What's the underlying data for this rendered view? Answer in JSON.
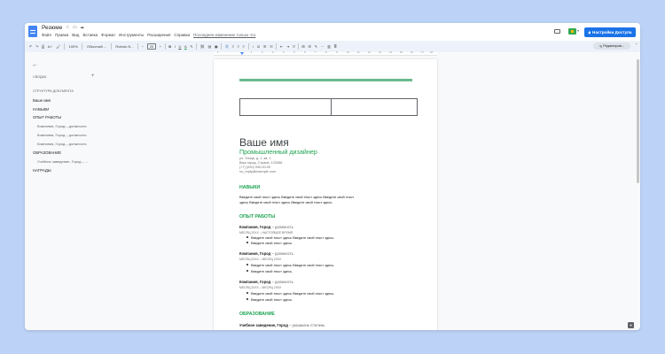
{
  "header": {
    "title": "Резюме",
    "menu": [
      "Файл",
      "Правка",
      "Вид",
      "Вставка",
      "Формат",
      "Инструменты",
      "Расширения",
      "Справка"
    ],
    "last_edit": "Последнее изменение только что",
    "share_label": "Настройки Доступа"
  },
  "toolbar": {
    "zoom": "100%",
    "style": "Обычный ...",
    "font": "Roboto N...",
    "font_size": "20",
    "edit_mode": "Редактиров..."
  },
  "ruler": {
    "numbers": [
      "1",
      "1",
      "2",
      "3",
      "4",
      "5",
      "6",
      "7",
      "8",
      "9",
      "10",
      "11",
      "12",
      "13",
      "14",
      "15",
      "16",
      "17",
      "18"
    ]
  },
  "sidebar": {
    "summary_label": "СВОДКА",
    "outline_label": "СТРУКТУРА ДОКУМЕНТА",
    "items": [
      {
        "label": "Ваше имя"
      },
      {
        "label": "НАВЫКИ"
      },
      {
        "label": "ОПЫТ РАБОТЫ"
      },
      {
        "label": "Компания, Город – должность"
      },
      {
        "label": "Компания, Город – должность"
      },
      {
        "label": "Компания, Город – должность"
      },
      {
        "label": "ОБРАЗОВАНИЕ"
      },
      {
        "label": "Учебное заведение, Город – ..."
      },
      {
        "label": "НАГРАДЫ"
      }
    ]
  },
  "doc": {
    "name": "Ваше имя",
    "role": "Промышленный дизайнер",
    "contact": [
      "ул. Улица, д. 1, кв. 1",
      "Ваш город, Страна, 123456",
      "(+7) (000) 000-00-00",
      "no_reply@example.com"
    ],
    "skills_heading": "НАВЫКИ",
    "skills_text": [
      "Введите свой текст здесь Введите свой текст здесь Введите свой текст",
      "здесь Введите свой текст здесь Введите свой текст здесь."
    ],
    "experience_heading": "ОПЫТ РАБОТЫ",
    "jobs": [
      {
        "company": "Компания, Город",
        "role": " – должность",
        "dates": "МЕСЯЦ 20XX – НАСТОЯЩЕЕ ВРЕМЯ",
        "bullets": [
          "Введите свой текст здесь Введите свой текст здесь.",
          "Введите свой текст здесь."
        ]
      },
      {
        "company": "Компания, Город",
        "role": " – должность",
        "dates": "МЕСЯЦ 20XX – МЕСЯЦ 20XX",
        "bullets": [
          "Введите свой текст здесь Введите свой текст здесь.",
          "Введите свой текст здесь."
        ]
      },
      {
        "company": "Компания, Город",
        "role": " – должность",
        "dates": "МЕСЯЦ 20XX – МЕСЯЦ 20XX",
        "bullets": [
          "Введите свой текст здесь Введите свой текст здесь.",
          "Введите свой текст здесь."
        ]
      }
    ],
    "education_heading": "ОБРАЗОВАНИЕ",
    "school": {
      "name": "Учебное заведение, Город",
      "degree": " – указаначь Степень"
    }
  }
}
